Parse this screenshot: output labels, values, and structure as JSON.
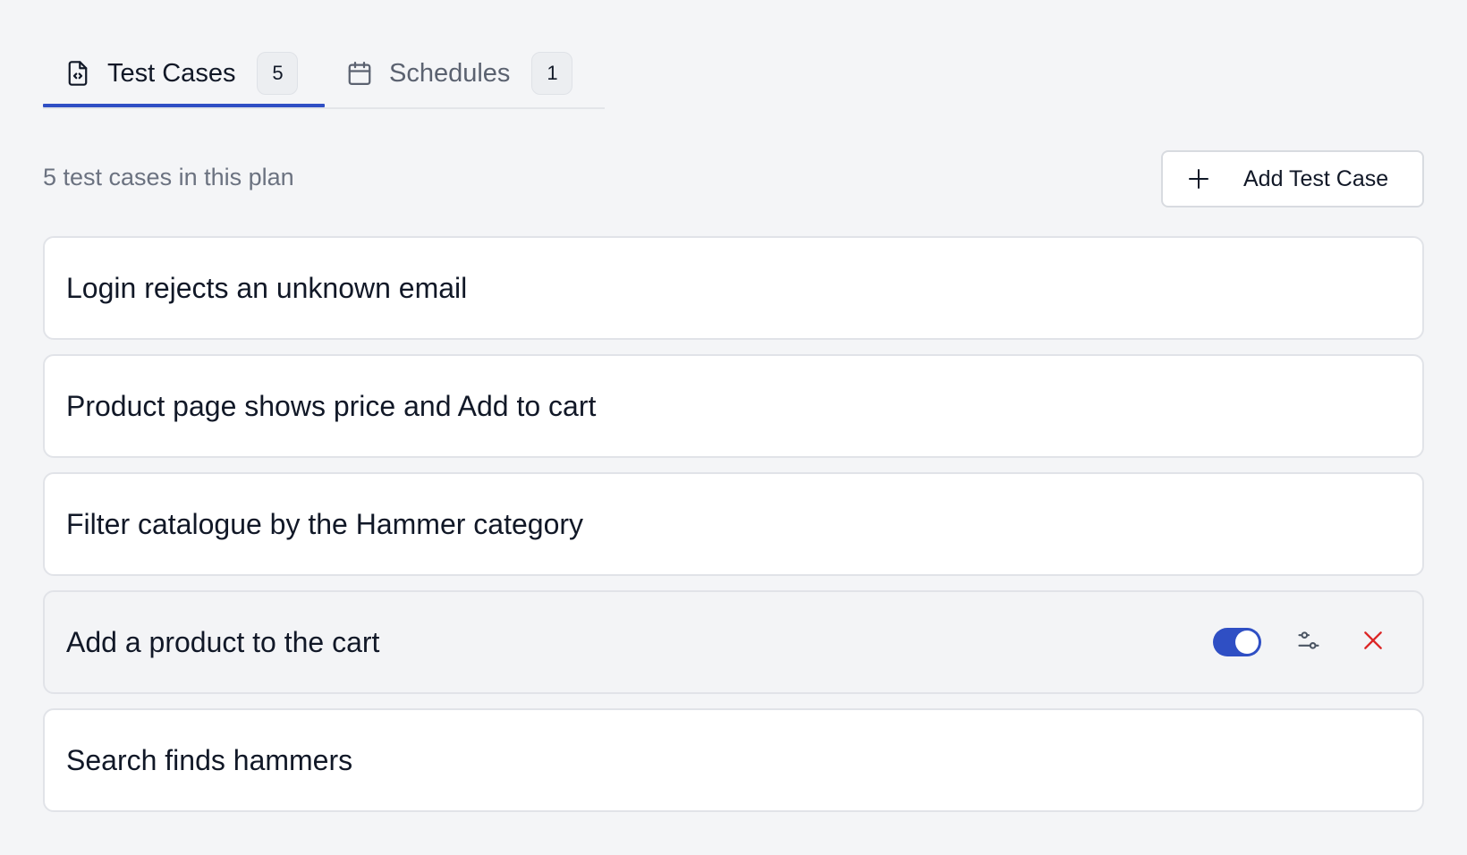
{
  "tabs": [
    {
      "label": "Test Cases",
      "count": "5",
      "icon": "file-code-icon",
      "active": true
    },
    {
      "label": "Schedules",
      "count": "1",
      "icon": "calendar-icon",
      "active": false
    }
  ],
  "summary": "5 test cases in this plan",
  "add_button": {
    "label": "Add Test Case",
    "icon": "plus-icon"
  },
  "test_cases": [
    {
      "title": "Login rejects an unknown email"
    },
    {
      "title": "Product page shows price and Add to cart"
    },
    {
      "title": "Filter catalogue by the Hammer category"
    },
    {
      "title": "Add a product to the cart",
      "hovered": true,
      "enabled": true
    },
    {
      "title": "Search finds hammers"
    }
  ],
  "colors": {
    "accent": "#2f4fc4",
    "danger": "#dc2626",
    "background": "#f4f5f7"
  }
}
